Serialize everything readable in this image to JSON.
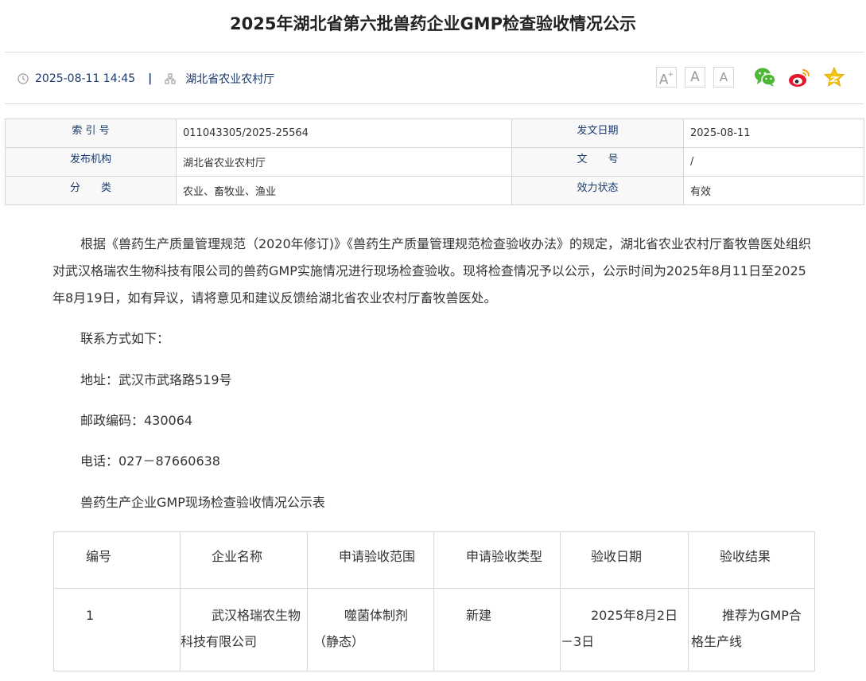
{
  "title": "2025年湖北省第六批兽药企业GMP检查验收情况公示",
  "meta_bar": {
    "datetime": "2025-08-11 14:45",
    "separator": "|",
    "source": "湖北省农业农村厅",
    "font_large": "A",
    "font_large_sup": "+",
    "font_medium": "A",
    "font_small": "A",
    "share_icons": [
      "wechat-icon",
      "weibo-icon",
      "favorite-star-icon"
    ],
    "colors": {
      "wechat": "#4cb733",
      "weibo": "#e6162d",
      "weibo_orange": "#f5a623",
      "star": "#f5c518",
      "link": "#1a3a6e"
    }
  },
  "info_table": {
    "rows": [
      {
        "k1": "索 引 号",
        "v1": "011043305/2025-25564",
        "k2": "发文日期",
        "v2": "2025-08-11"
      },
      {
        "k1": "发布机构",
        "v1": "湖北省农业农村厅",
        "k2": "文　　号",
        "v2": "/"
      },
      {
        "k1": "分　　类",
        "v1": "农业、畜牧业、渔业",
        "k2": "效力状态",
        "v2": "有效"
      }
    ]
  },
  "body": {
    "intro": "根据《兽药生产质量管理规范（2020年修订)》《兽药生产质量管理规范检查验收办法》的规定，湖北省农业农村厅畜牧兽医处组织对武汉格瑞农生物科技有限公司的兽药GMP实施情况进行现场检查验收。现将检查情况予以公示，公示时间为2025年8月11日至2025年8月19日，如有异议，请将意见和建议反馈给湖北省农业农村厅畜牧兽医处。",
    "contact_heading": "联系方式如下：",
    "address": "地址：武汉市武珞路519号",
    "postcode": "邮政编码：430064",
    "phone": "电话：027－87660638",
    "table_caption": "兽药生产企业GMP现场检查验收情况公示表"
  },
  "gmp_table": {
    "headers": [
      "编号",
      "企业名称",
      "申请验收范围",
      "申请验收类型",
      "验收日期",
      "验收结果"
    ],
    "rows": [
      [
        "1",
        "武汉格瑞农生物科技有限公司",
        "噬菌体制剂（静态）",
        "新建",
        "2025年8月2日－3日",
        "推荐为GMP合格生产线"
      ]
    ]
  }
}
